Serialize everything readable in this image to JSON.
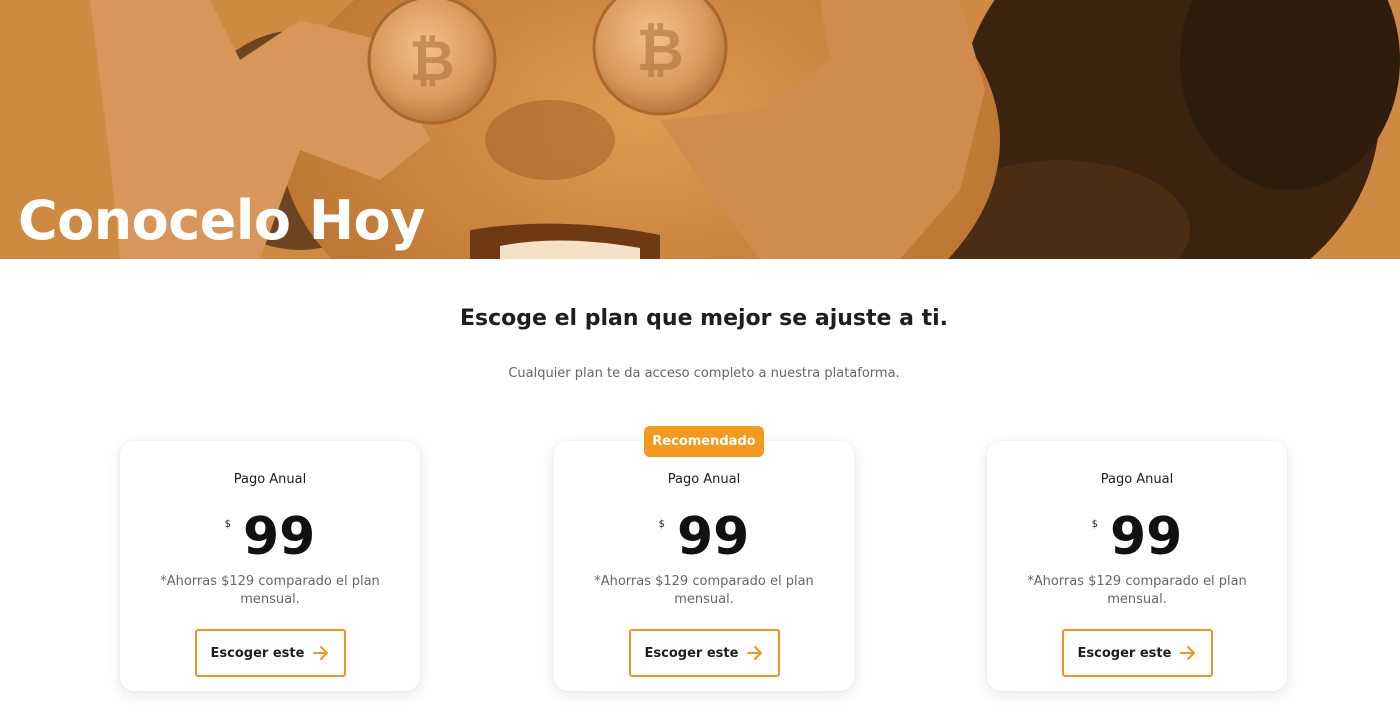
{
  "hero": {
    "title": "Conocelo Hoy"
  },
  "pricing": {
    "heading": "Escoge el plan que mejor se ajuste a ti.",
    "subheading": "Cualquier plan te da acceso completo a nuestra plataforma.",
    "plans": [
      {
        "name": "Pago Anual",
        "currency": "$",
        "price": "99",
        "note": "*Ahorras $129 comparado el plan mensual.",
        "button_label": "Escoger este",
        "badge": ""
      },
      {
        "name": "Pago Anual",
        "currency": "$",
        "price": "99",
        "note": "*Ahorras $129 comparado el plan mensual.",
        "button_label": "Escoger este",
        "badge": "Recomendado"
      },
      {
        "name": "Pago Anual",
        "currency": "$",
        "price": "99",
        "note": "*Ahorras $129 comparado el plan mensual.",
        "button_label": "Escoger este",
        "badge": ""
      }
    ]
  },
  "colors": {
    "accent": "#f39a1e",
    "hero_tint": "#c97f36"
  },
  "icons": {
    "button_icon": "arrow-right-icon"
  }
}
